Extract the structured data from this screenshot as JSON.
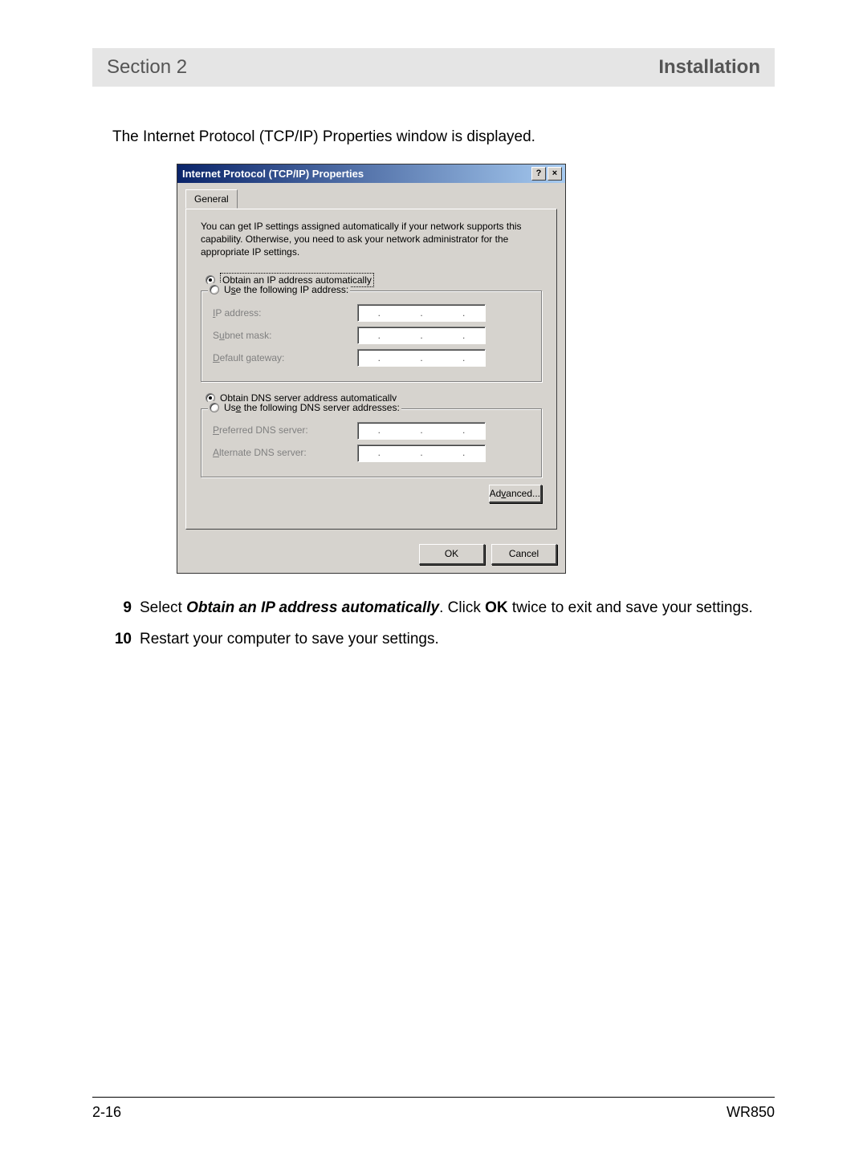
{
  "header": {
    "section_label": "Section 2",
    "chapter_title": "Installation"
  },
  "intro": "The Internet Protocol (TCP/IP) Properties window is displayed.",
  "dialog": {
    "title": "Internet Protocol (TCP/IP) Properties",
    "help_glyph": "?",
    "close_glyph": "×",
    "tab_general": "General",
    "description": "You can get IP settings assigned automatically if your network supports this capability. Otherwise, you need to ask your network administrator for the appropriate IP settings.",
    "radio_obtain_ip": "Obtain an IP address automatically",
    "radio_use_ip": "Use the following IP address:",
    "ip_address_label": "IP address:",
    "subnet_label": "Subnet mask:",
    "gateway_label": "Default gateway:",
    "radio_obtain_dns": "Obtain DNS server address automatically",
    "radio_use_dns": "Use the following DNS server addresses:",
    "pref_dns_label": "Preferred DNS server:",
    "alt_dns_label": "Alternate DNS server:",
    "advanced_btn": "Advanced...",
    "ok_btn": "OK",
    "cancel_btn": "Cancel"
  },
  "steps": {
    "s9_num": "9",
    "s9_pre": "Select ",
    "s9_bold_italic": "Obtain an IP address automatically",
    "s9_mid": ". Click ",
    "s9_bold": "OK",
    "s9_post": " twice to exit and save your settings.",
    "s10_num": "10",
    "s10_text": "Restart your computer to save your settings."
  },
  "footer": {
    "page_num": "2-16",
    "model": "WR850"
  }
}
